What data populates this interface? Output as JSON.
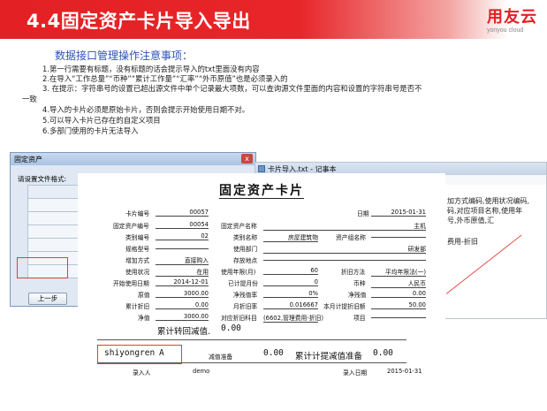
{
  "title": "4.4固定资产卡片导入导出",
  "logo": {
    "text": "用友云",
    "sub": "yonyou cloud"
  },
  "subtitle": "数据接口管理操作注意事项：",
  "notes": [
    "1.第一行需要有标题，没有标题的话会提示导入的txt里面没有内容",
    "2.在导入“工作总量”“币种”“累计工作量”“汇率”“外币原值”也是必须录入的",
    "3. 在提示：字符串号的设置已超出源文件中单个记录最大项数，可以查询源文件里面的内容和设置的字符串号是否不",
    "一致",
    "4.导入的卡片必须是原始卡片，否则会提示开始使用日期不对。",
    "5.可以导入卡片已存在的自定义项目",
    "6.多部门使用的卡片无法导入"
  ],
  "import_window": {
    "title": "固定资产",
    "close": "x",
    "label": "请设置文件格式:",
    "header": "序号",
    "rows": [
      "18",
      "19",
      "20",
      "21",
      "22",
      "23"
    ],
    "prev_button": "上一步"
  },
  "notepad": {
    "title": "卡片导入.txt - 记事本",
    "menu": "文件(F)  编辑(E)  格式(O)",
    "right_text": [
      "加方式编码,使用状况编码,",
      "码,对应项目名称,使用年",
      "号,外币原值,汇",
      "费用-折旧"
    ]
  },
  "card": {
    "title": "固定资产卡片",
    "fields": {
      "card_no_label": "卡片编号",
      "card_no": "00057",
      "date_label": "日期",
      "date": "2015-01-31",
      "asset_no_label": "固定资产编号",
      "asset_no": "00054",
      "asset_name_label": "固定资产名称",
      "asset_name": "主机",
      "cat_no_label": "类别编号",
      "cat_no": "02",
      "cat_name_label": "类别名称",
      "cat_name": "房屋建筑物",
      "group_label": "资产组名称",
      "group": "",
      "spec_label": "规格型号",
      "spec": "",
      "dept_label": "使用部门",
      "dept": "研发部",
      "add_label": "增加方式",
      "add": "直接购入",
      "loc_label": "存放地点",
      "loc": "",
      "status_label": "使用状况",
      "status": "在用",
      "life_label": "使用年限(月)",
      "life": "60",
      "method_label": "折旧方法",
      "method": "平均年限法(一)",
      "start_label": "开始使用日期",
      "start": "2014-12-01",
      "accrued_label": "已计提月份",
      "accrued": "0",
      "currency_label": "币种",
      "currency": "人民币",
      "orig_label": "原值",
      "orig": "3000.00",
      "salv_rate_label": "净残值率",
      "salv_rate": "0%",
      "salv_label": "净残值",
      "salv": "0.00",
      "acc_dep_label": "累计折旧",
      "acc_dep": "0.00",
      "mrate_label": "月折旧率",
      "mrate": "0.016667",
      "mdep_label": "本月计提折旧额",
      "mdep": "50.00",
      "net_label": "净值",
      "net": "3000.00",
      "subj_label": "对应折旧科目",
      "subj": "(6602,管理费用-折旧)",
      "item_label": "项目",
      "item": ""
    },
    "acc_write_back_label": "累计转回减值.",
    "acc_write_back": "0.00",
    "user_code": "shiyongren",
    "user_code_suffix": "A",
    "impair_label": "减值准备",
    "impair": "0.00",
    "acc_impair_label": "累计计提减值准备",
    "acc_impair": "0.00",
    "entry_label": "录入人",
    "entry": "demo",
    "entry_date_label": "录入日期",
    "entry_date": "2015-01-31"
  },
  "colors": {
    "brand_red": "#e32023",
    "subtitle_blue": "#2f52b8",
    "highlight_red": "#e83a3a"
  }
}
